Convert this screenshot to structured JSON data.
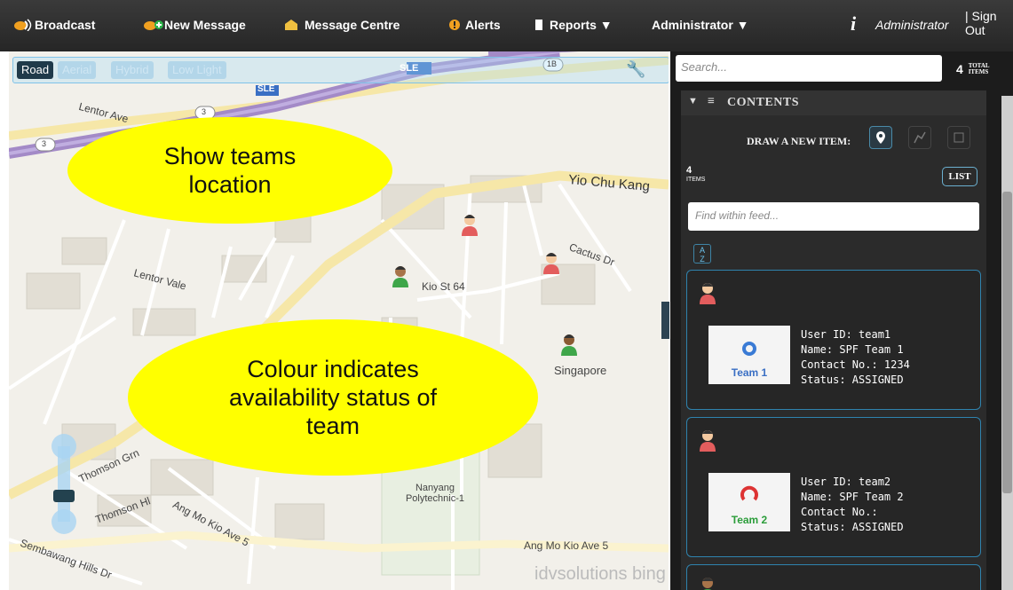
{
  "nav": {
    "items": [
      {
        "label": "Broadcast",
        "icon": "broadcast-icon"
      },
      {
        "label": "New Message",
        "icon": "new-message-icon"
      },
      {
        "label": "Message Centre",
        "icon": "message-centre-icon"
      },
      {
        "label": "Alerts",
        "icon": "alert-icon"
      },
      {
        "label": "Reports ▼",
        "icon": "reports-icon"
      },
      {
        "label": "Administrator ▼",
        "icon": ""
      }
    ],
    "user": "Administrator",
    "info_icon": "i",
    "signout": "| Sign Out"
  },
  "map": {
    "types": [
      "Road",
      "Aerial",
      "Hybrid",
      "Low Light"
    ],
    "active_type": "Road",
    "callouts": [
      "Show teams location",
      "Colour indicates availability status of team"
    ],
    "labels": [
      {
        "text": "Lentor Ave"
      },
      {
        "text": "Yio Chu Kang"
      },
      {
        "text": "Lentor Vale"
      },
      {
        "text": "Kio St 64"
      },
      {
        "text": "Cactus Dr"
      },
      {
        "text": "Singapore"
      },
      {
        "text": "Nanyang Polytechnic-1"
      },
      {
        "text": "Ang Mo Kio Ave 5"
      },
      {
        "text": "Thomson Grn"
      },
      {
        "text": "Thomson Hl"
      },
      {
        "text": "Sembawang Hills Dr"
      },
      {
        "text": "SLE"
      },
      {
        "text": "1B"
      },
      {
        "text": "3"
      }
    ],
    "attribution": "idvsolutions  bing"
  },
  "panel": {
    "search_placeholder": "Search...",
    "total_count": "4",
    "total_label": "TOTAL ITEMS",
    "contents_title": "CONTENTS",
    "draw_label": "DRAW A NEW ITEM:",
    "items_count": "4",
    "items_label": "ITEMS",
    "list_button": "LIST",
    "find_placeholder": "Find within feed...",
    "sort_label": "A Z",
    "cards": [
      {
        "user_id": "User ID: team1",
        "name": "Name: SPF Team 1",
        "contact": "Contact No.: 1234",
        "status": "Status: ASSIGNED",
        "logo_text": "Team 1",
        "color": "#e35d5d"
      },
      {
        "user_id": "User ID: team2",
        "name": "Name: SPF Team 2",
        "contact": "Contact No.:",
        "status": "Status: ASSIGNED",
        "logo_text": "Team 2",
        "color": "#e35d5d"
      }
    ]
  }
}
